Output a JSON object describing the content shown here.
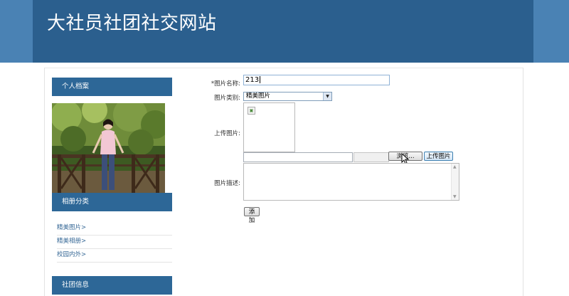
{
  "header": {
    "site_title": "大社员社团社交网站"
  },
  "sidebar": {
    "profile_heading": "个人档案",
    "album_heading": "相册分类",
    "album_items": [
      {
        "label": "精美图片>"
      },
      {
        "label": "精美相册>"
      },
      {
        "label": "校园内外>"
      }
    ],
    "club_heading": "社团信息"
  },
  "form": {
    "name_label": "*图片名称:",
    "name_value": "213",
    "category_label": "图片类别:",
    "category_value": "精美图片",
    "upload_label": "上传图片:",
    "browse_label": "浏览...",
    "upload_button": "上传图片",
    "desc_label": "图片描述:",
    "desc_value": "",
    "submit_label": "添加"
  }
}
